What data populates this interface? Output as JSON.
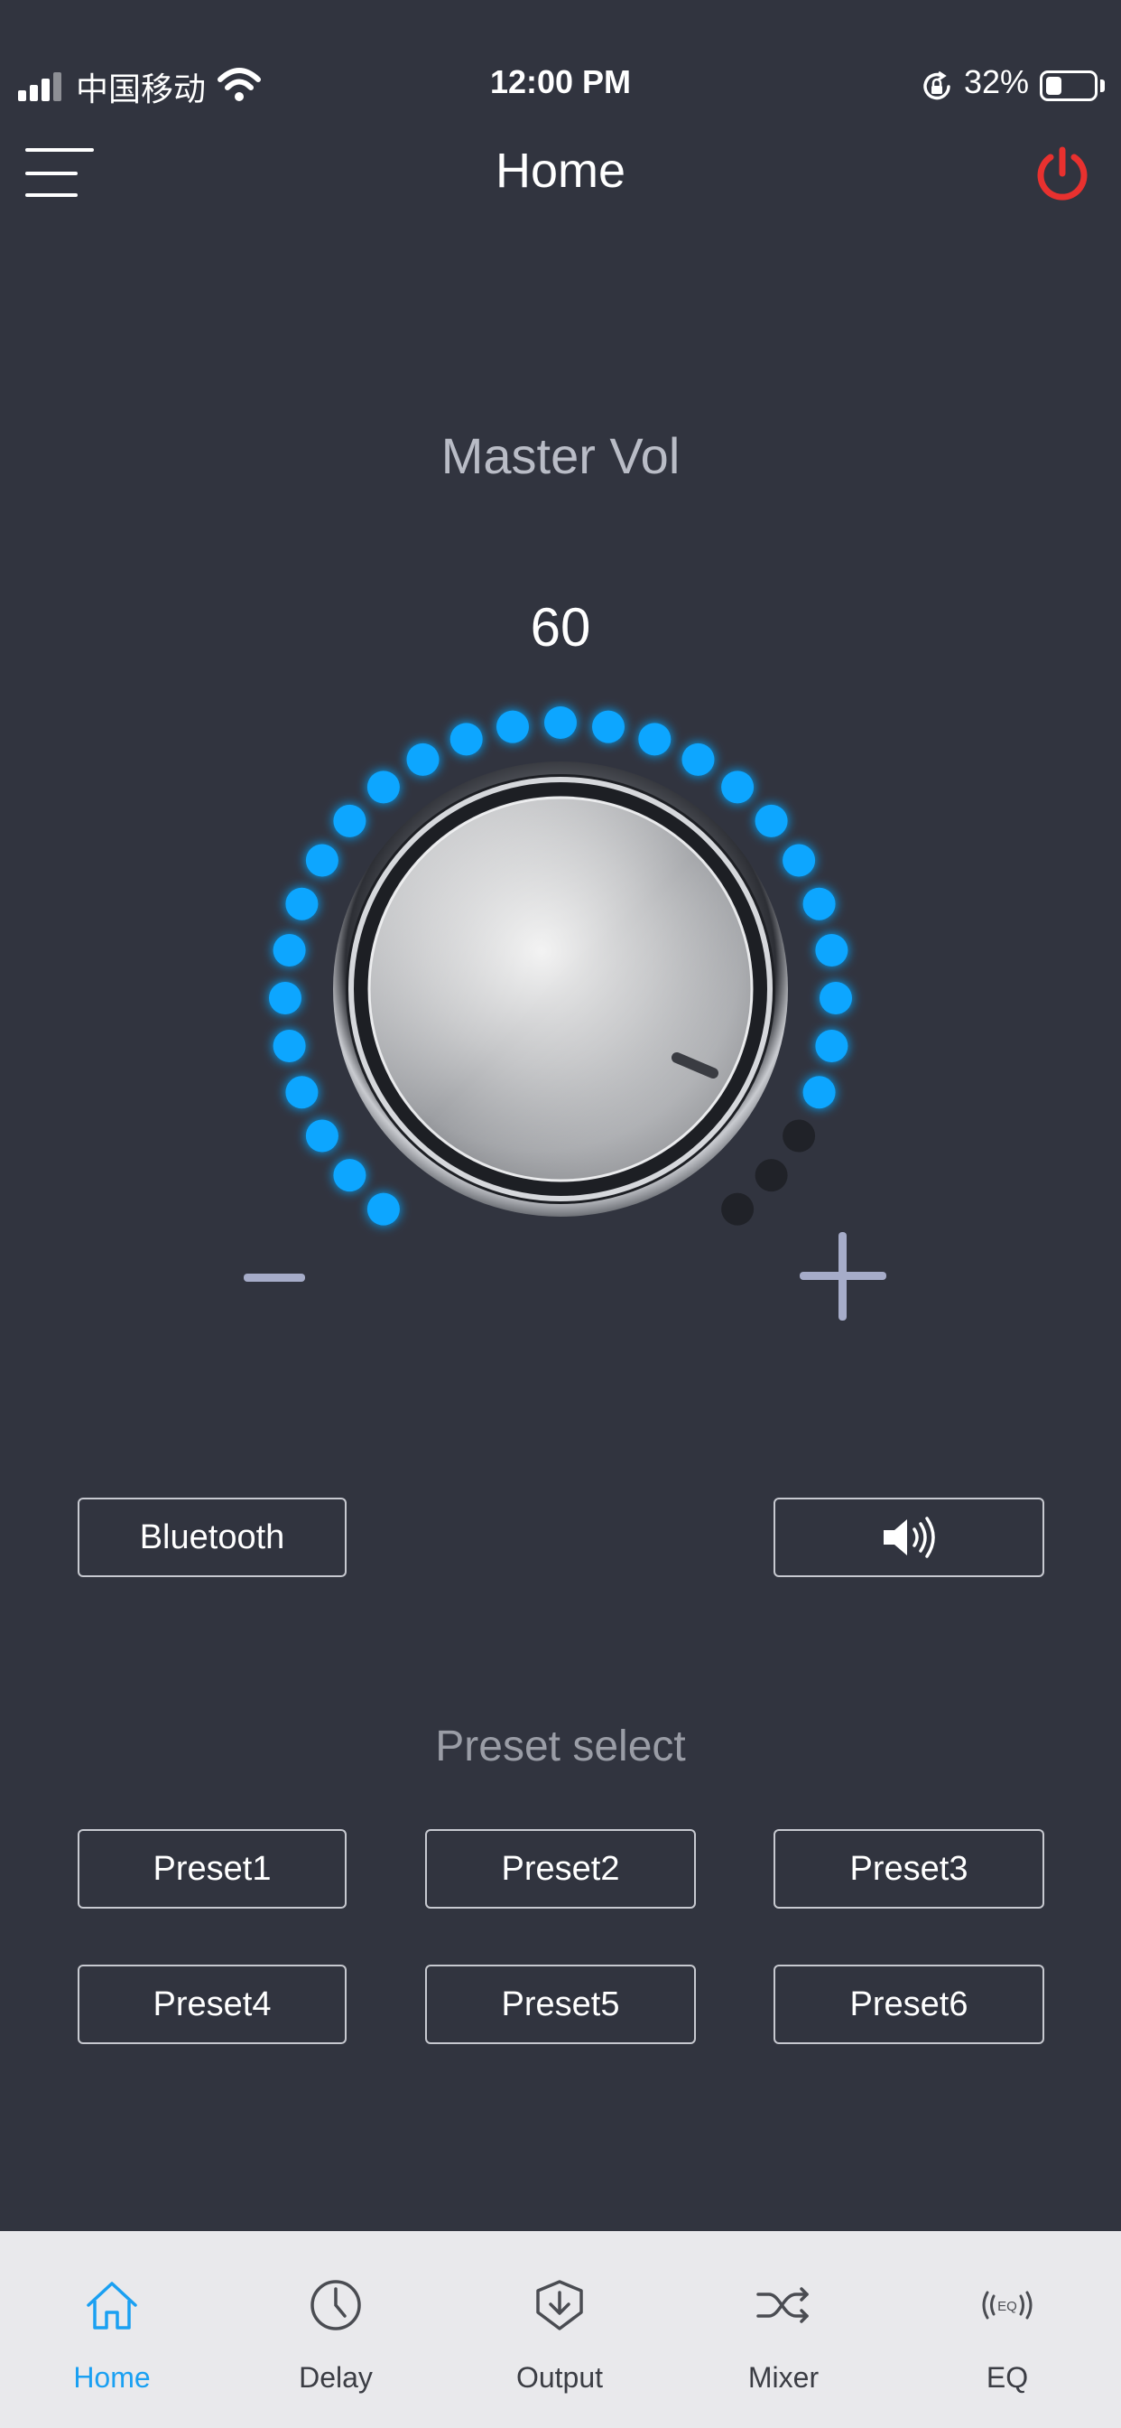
{
  "status_bar": {
    "carrier": "中国移动",
    "time": "12:00 PM",
    "battery_percent": "32%",
    "battery_level": 0.32
  },
  "header": {
    "title": "Home",
    "menu_icon": "hamburger-icon",
    "power_icon": "power-icon",
    "power_color": "#e8312f"
  },
  "master": {
    "label": "Master Vol",
    "value": "60",
    "active_dots": 26,
    "total_dots": 29,
    "active_color": "#0fa6ff",
    "inactive_color": "#202228"
  },
  "buttons": {
    "bluetooth_label": "Bluetooth",
    "speaker_icon": "speaker-icon"
  },
  "presets": {
    "label": "Preset select",
    "items": [
      "Preset1",
      "Preset2",
      "Preset3",
      "Preset4",
      "Preset5",
      "Preset6"
    ]
  },
  "tabs": [
    {
      "label": "Home",
      "icon": "home-icon",
      "active": true
    },
    {
      "label": "Delay",
      "icon": "clock-icon",
      "active": false
    },
    {
      "label": "Output",
      "icon": "output-icon",
      "active": false
    },
    {
      "label": "Mixer",
      "icon": "shuffle-icon",
      "active": false
    },
    {
      "label": "EQ",
      "icon": "eq-icon",
      "active": false
    }
  ],
  "colors": {
    "background": "#31343f",
    "accent": "#1aa0f2",
    "tab_bar": "#e9e9ec"
  }
}
